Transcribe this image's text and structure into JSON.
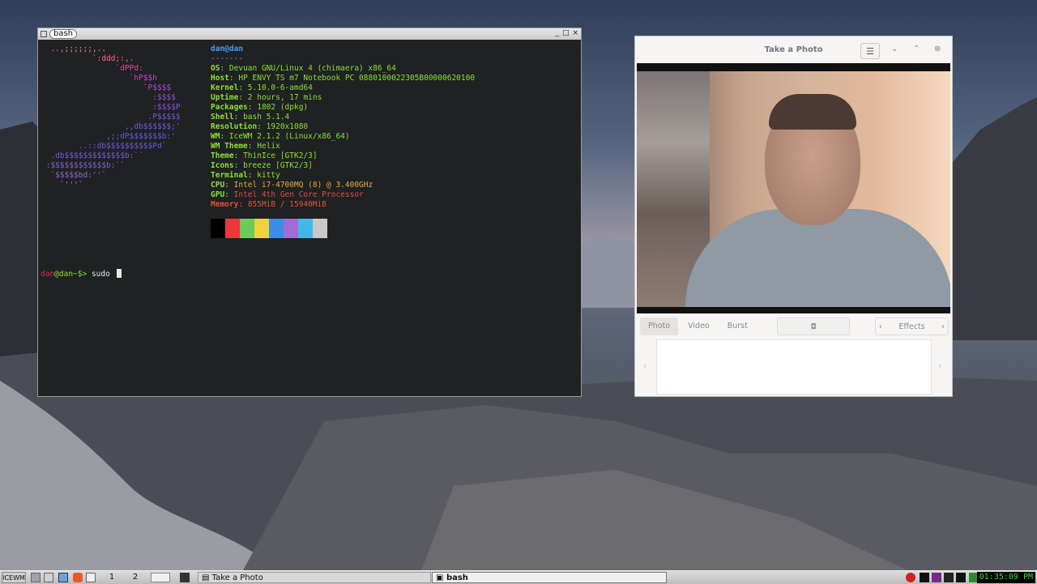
{
  "terminal": {
    "title": "bash",
    "window_buttons": [
      "_",
      "□",
      "×"
    ],
    "logo_lines": [
      {
        "text": "  ..,;;;;;;,..",
        "color": "#ff7a9a"
      },
      {
        "text": "           `:ddd;:,.",
        "color": "#ff6a8a"
      },
      {
        "text": "                `dPPd:",
        "color": "#e84aa0"
      },
      {
        "text": "                   `hP$$h",
        "color": "#c84bc4"
      },
      {
        "text": "                      `P$$$$",
        "color": "#b04cd8"
      },
      {
        "text": "                        :$$$$",
        "color": "#9a4ee0"
      },
      {
        "text": "                        :$$$$P",
        "color": "#8a52e4"
      },
      {
        "text": "                       .P$$$$$",
        "color": "#7e56e6"
      },
      {
        "text": "                  ,,db$$$$$$;'",
        "color": "#7458e6"
      },
      {
        "text": "              ,;;dP$$$$$$$b:'",
        "color": "#6a5ae4"
      },
      {
        "text": "        ..::db$$$$$$$$$$Pd`",
        "color": "#665ce0"
      },
      {
        "text": "  .db$$$$$$$$$$$$$b:``",
        "color": "#7a5cdc"
      },
      {
        "text": " :$$$$$$$$$$$$b:``",
        "color": "#8a60d8"
      },
      {
        "text": "  `$$$$$bd:''`",
        "color": "#9466d4"
      },
      {
        "text": "    `'''`",
        "color": "#9a9acb"
      }
    ],
    "user_host": "dan@dan",
    "separator": "-------",
    "info": [
      {
        "key": "OS",
        "value": "Devuan GNU/Linux 4 (chimaera) x86_64"
      },
      {
        "key": "Host",
        "value": "HP ENVY TS m7 Notebook PC 0880100022305B00000620100"
      },
      {
        "key": "Kernel",
        "value": "5.10.0-6-amd64"
      },
      {
        "key": "Uptime",
        "value": "2 hours, 17 mins"
      },
      {
        "key": "Packages",
        "value": "1802 (dpkg)"
      },
      {
        "key": "Shell",
        "value": "bash 5.1.4"
      },
      {
        "key": "Resolution",
        "value": "1920x1080"
      },
      {
        "key": "WM",
        "value": "IceWM 2.1.2 (Linux/x86_64)"
      },
      {
        "key": "WM Theme",
        "value": "Helix"
      },
      {
        "key": "Theme",
        "value": "ThinIce [GTK2/3]"
      },
      {
        "key": "Icons",
        "value": "breeze [GTK2/3]"
      },
      {
        "key": "Terminal",
        "value": "kitty"
      },
      {
        "key": "CPU",
        "value": "Intel i7-4700MQ (8) @ 3.400GHz"
      },
      {
        "key": "GPU",
        "value": "Intel 4th Gen Core Processor"
      },
      {
        "key": "Memory",
        "value": "855MiB / 15940MiB"
      }
    ],
    "info_colors": {
      "key_default": "#8ae234",
      "value_default": "#8ae234",
      "cpu_value": "#e5a93a",
      "gpu_value": "#e14a4a",
      "memory": "#e5533a",
      "title": "#4a9bff"
    },
    "palette": [
      "#000000",
      "#e8383a",
      "#6ccb58",
      "#f1d23a",
      "#3a8ee8",
      "#a46ad6",
      "#42b8e8",
      "#c8c8c8"
    ],
    "prompt": {
      "user": "dan",
      "rest": "@dan~$> ",
      "command": "sudo "
    }
  },
  "camera": {
    "title": "Take a Photo",
    "menu_icon": "hamburger-menu-icon",
    "modes": [
      "Photo",
      "Video",
      "Burst"
    ],
    "active_mode": "Photo",
    "shutter_icon": "camera-icon",
    "effects_label": "Effects"
  },
  "taskbar": {
    "start_label": "ICEWM",
    "workspaces": [
      "1",
      "2"
    ],
    "tasks": [
      {
        "label": "Take a Photo",
        "active": false
      },
      {
        "label": "bash",
        "active": true
      }
    ],
    "clock": "01:35:09 PM"
  }
}
